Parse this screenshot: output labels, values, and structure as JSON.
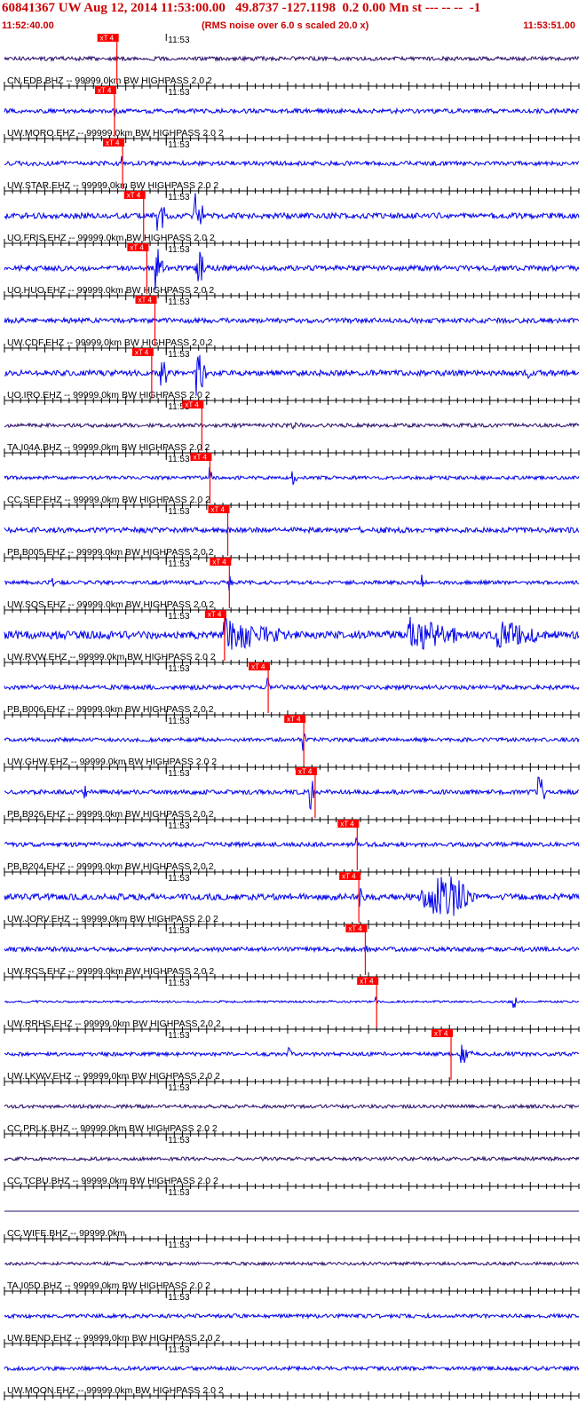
{
  "header": {
    "title": "60841367 UW Aug 12, 2014 11:53:00.00   49.8737 -127.1198  0.2 0.00 Mn st --- -- --  -1",
    "start_time": "11:52:40.00",
    "subtitle": "(RMS noise over 6.0 s scaled 20.0 x)",
    "end_time": "11:53:51.00"
  },
  "colors": {
    "trace": "#0000ee",
    "trace_dark": "#2a0a6a",
    "pick": "#ff0000",
    "text": "#cc0000",
    "axis": "#000000"
  },
  "chart_data": {
    "type": "line",
    "title": "60841367 UW Aug 12, 2014 11:53:00.00   49.8737 -127.1198  0.2 0.00 Mn st --- -- --  -1",
    "subtitle": "(RMS noise over 6.0 s scaled 20.0 x)",
    "x_start": "11:52:40.00",
    "x_end": "11:53:51.00",
    "time_range_s": [
      0,
      71
    ],
    "tick_label": "11:53",
    "tick_label_time_s": 20,
    "pick_label": "xT 4",
    "grid": false,
    "legend": "none",
    "series": [
      {
        "name": "CN.EDB.BHZ -- 99999.0km BW  HIGHPASS  2.0  2",
        "pick_s": 13.9,
        "amp": 2.2,
        "dark": true,
        "events": []
      },
      {
        "name": "UW.MORO.EHZ -- 99999.0km BW  HIGHPASS  2.0  2",
        "pick_s": 13.6,
        "amp": 2.5,
        "dark": false,
        "events": [
          [
            13.6,
            9,
            1.2,
            14
          ]
        ]
      },
      {
        "name": "UW.STAR.EHZ -- 99999.0km BW  HIGHPASS  2.0  2",
        "pick_s": 14.6,
        "amp": 2.5,
        "dark": false,
        "events": [
          [
            14.6,
            11,
            1.0,
            14
          ]
        ]
      },
      {
        "name": "UO.FRIS.EHZ -- 99999.0km BW  HIGHPASS  2.0  2",
        "pick_s": 17.2,
        "amp": 3.2,
        "dark": false,
        "events": [
          [
            19.0,
            28,
            0.8,
            1
          ],
          [
            23.6,
            28,
            1.2,
            1
          ],
          [
            64.0,
            6,
            1.0,
            3
          ]
        ]
      },
      {
        "name": "UO.HUO.EHZ -- 99999.0km BW  HIGHPASS  2.0  2",
        "pick_s": 17.6,
        "amp": 3.0,
        "dark": false,
        "events": [
          [
            18.8,
            28,
            0.9,
            1
          ],
          [
            23.8,
            28,
            1.0,
            1
          ]
        ]
      },
      {
        "name": "UW.CDF.EHZ -- 99999.0km BW  HIGHPASS  2.0  2",
        "pick_s": 18.6,
        "amp": 2.8,
        "dark": false,
        "events": []
      },
      {
        "name": "UO.IRO.EHZ -- 99999.0km BW  HIGHPASS  2.0  2",
        "pick_s": 18.2,
        "amp": 3.2,
        "dark": false,
        "events": [
          [
            19.4,
            28,
            0.9,
            1
          ],
          [
            23.8,
            28,
            1.2,
            1
          ],
          [
            64.8,
            6,
            1.0,
            3
          ]
        ]
      },
      {
        "name": "TA.I04A.BHZ -- 99999.0km BW  HIGHPASS  2.0  2",
        "pick_s": 24.4,
        "amp": 2.2,
        "dark": true,
        "events": [
          [
            35.0,
            5,
            8.0,
            3
          ]
        ]
      },
      {
        "name": "CC.SEP.EHZ -- 99999.0km BW  HIGHPASS  2.0  2",
        "pick_s": 25.4,
        "amp": 2.0,
        "dark": false,
        "events": [
          [
            25.4,
            12,
            1.0,
            3
          ],
          [
            35.6,
            14,
            1.2,
            3
          ]
        ]
      },
      {
        "name": "PB.B005.EHZ -- 99999.0km BW  HIGHPASS  2.0  2",
        "pick_s": 27.6,
        "amp": 3.0,
        "dark": false,
        "events": [
          [
            4.0,
            5,
            0.6,
            3
          ],
          [
            14.0,
            5,
            0.6,
            3
          ],
          [
            44.0,
            5,
            0.6,
            3
          ]
        ]
      },
      {
        "name": "UW.SQS.EHZ -- 99999.0km BW  HIGHPASS  2.0  2",
        "pick_s": 27.8,
        "amp": 2.2,
        "dark": false,
        "events": [
          [
            6.0,
            10,
            0.6,
            3
          ],
          [
            27.8,
            10,
            1.0,
            3
          ],
          [
            51.6,
            10,
            0.6,
            3
          ]
        ]
      },
      {
        "name": "UW.RVW.EHZ -- 99999.0km BW  HIGHPASS  2.0  2",
        "pick_s": 27.2,
        "amp": 4.5,
        "dark": false,
        "events": [
          [
            27.2,
            22,
            7.0,
            1
          ],
          [
            50.0,
            24,
            6.0,
            1
          ],
          [
            61.0,
            18,
            6.0,
            1
          ]
        ]
      },
      {
        "name": "PB.B006.EHZ -- 99999.0km BW  HIGHPASS  2.0  2",
        "pick_s": 32.6,
        "amp": 2.5,
        "dark": false,
        "events": [
          [
            32.6,
            10,
            0.8,
            3
          ],
          [
            4.0,
            5,
            0.6,
            3
          ]
        ]
      },
      {
        "name": "UW.GHW.EHZ -- 99999.0km BW  HIGHPASS  2.0  2",
        "pick_s": 37.0,
        "amp": 2.2,
        "dark": false,
        "events": [
          [
            37.0,
            18,
            0.6,
            3
          ]
        ]
      },
      {
        "name": "PB.B926.EHZ -- 99999.0km BW  HIGHPASS  2.0  2",
        "pick_s": 38.4,
        "amp": 2.5,
        "dark": false,
        "events": [
          [
            37.8,
            24,
            0.6,
            1
          ],
          [
            66.0,
            24,
            0.8,
            1
          ],
          [
            10.0,
            8,
            0.4,
            1
          ]
        ]
      },
      {
        "name": "PB.B204.EHZ -- 99999.0km BW  HIGHPASS  2.0  2",
        "pick_s": 43.6,
        "amp": 2.5,
        "dark": false,
        "events": [
          [
            43.6,
            8,
            1.0,
            3
          ]
        ]
      },
      {
        "name": "UW.JORV.EHZ -- 99999.0km BW  HIGHPASS  2.0  2",
        "pick_s": 43.8,
        "amp": 3.5,
        "dark": false,
        "events": [
          [
            44.0,
            12,
            1.5,
            3
          ],
          [
            50.5,
            24,
            8.0,
            4
          ]
        ]
      },
      {
        "name": "UW.RCS.EHZ -- 99999.0km BW  HIGHPASS  2.0  2",
        "pick_s": 44.6,
        "amp": 2.5,
        "dark": false,
        "events": [
          [
            44.6,
            10,
            1.5,
            3
          ]
        ]
      },
      {
        "name": "UW.RRHS.EHZ -- 99999.0km BW  HIGHPASS  2.0  2",
        "pick_s": 46.0,
        "amp": 1.2,
        "dark": false,
        "events": [
          [
            46.0,
            5,
            1.0,
            3
          ],
          [
            63.0,
            10,
            0.3,
            1
          ],
          [
            4.0,
            2.5,
            2.0,
            3
          ]
        ]
      },
      {
        "name": "UW.LKWV.EHZ -- 99999.0km BW  HIGHPASS  2.0  2",
        "pick_s": 55.2,
        "amp": 2.2,
        "dark": false,
        "events": [
          [
            56.5,
            16,
            2.5,
            3
          ],
          [
            35.2,
            10,
            0.3,
            1
          ]
        ]
      },
      {
        "name": "CC.PRLK.BHZ -- 99999.0km BW  HIGHPASS  2.0  2",
        "pick_s": null,
        "amp": 2.0,
        "dark": true,
        "events": []
      },
      {
        "name": "CC.TCBU.BHZ -- 99999.0km BW  HIGHPASS  2.0  2",
        "pick_s": null,
        "amp": 2.0,
        "dark": true,
        "events": []
      },
      {
        "name": "CC.WIFE.BHZ -- 99999.0km",
        "pick_s": null,
        "amp": 0.0,
        "dark": true,
        "events": []
      },
      {
        "name": "TA.I05D.BHZ -- 99999.0km BW  HIGHPASS  2.0  2",
        "pick_s": null,
        "amp": 1.8,
        "dark": true,
        "events": []
      },
      {
        "name": "UW.BEND.EHZ -- 99999.0km BW  HIGHPASS  2.0  2",
        "pick_s": null,
        "amp": 2.2,
        "dark": false,
        "events": []
      },
      {
        "name": "UW.MOON.EHZ -- 99999.0km BW  HIGHPASS  2.0  2",
        "pick_s": null,
        "amp": 2.2,
        "dark": false,
        "events": []
      }
    ]
  }
}
